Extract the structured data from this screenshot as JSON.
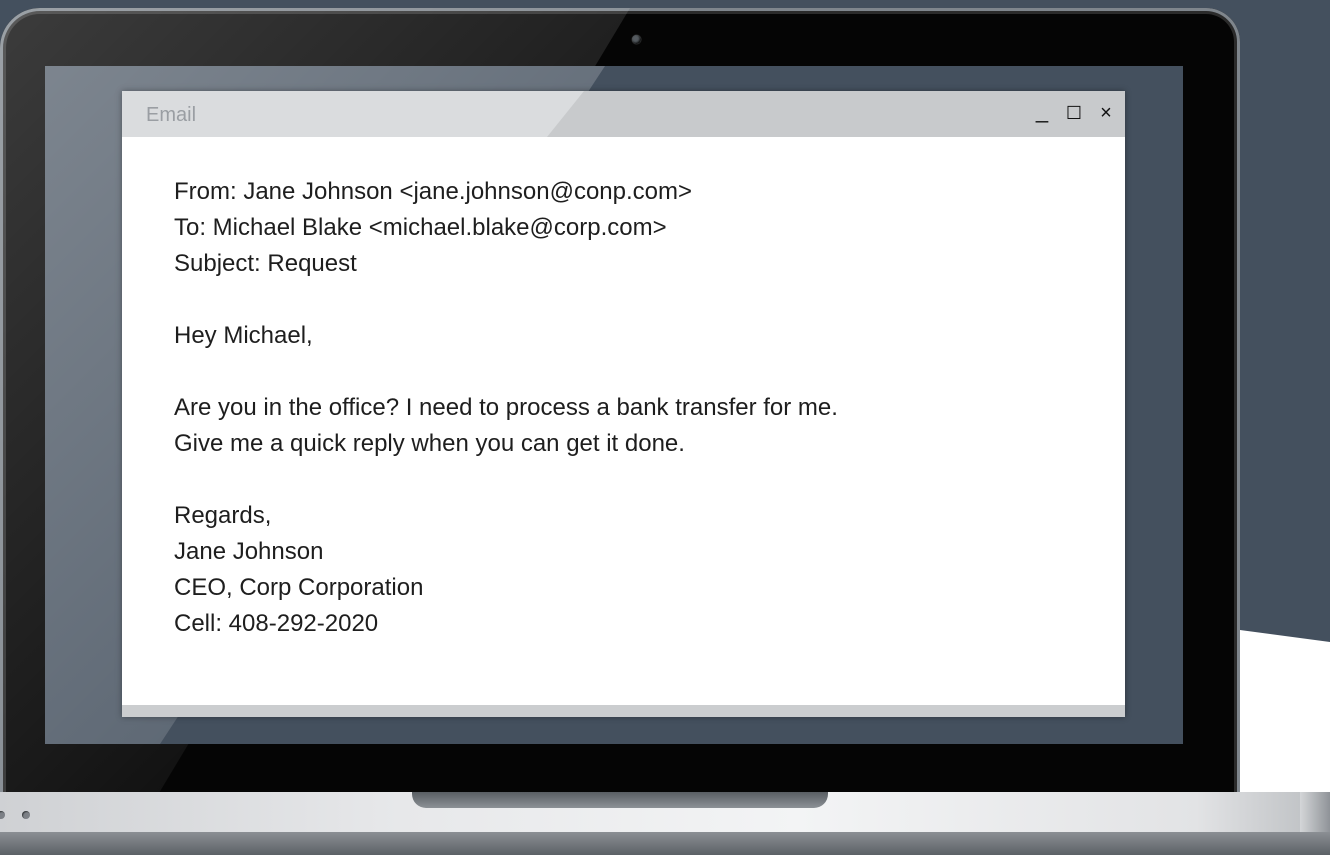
{
  "window": {
    "title": "Email",
    "controls": {
      "minimize": "_",
      "maximize": "☐",
      "close": "×"
    }
  },
  "email": {
    "from": "From: Jane Johnson <jane.johnson@conp.com>",
    "to": "To: Michael Blake <michael.blake@corp.com>",
    "subject": "Subject: Request",
    "greeting": "Hey Michael,",
    "body_line_1": "Are you in the office? I need to process a bank transfer for me.",
    "body_line_2": "Give me a quick reply when you can get it done.",
    "closing": "Regards,",
    "signature_name": "Jane Johnson",
    "signature_title": "CEO, Corp Corporation",
    "signature_cell": "Cell: 408-292-2020"
  }
}
